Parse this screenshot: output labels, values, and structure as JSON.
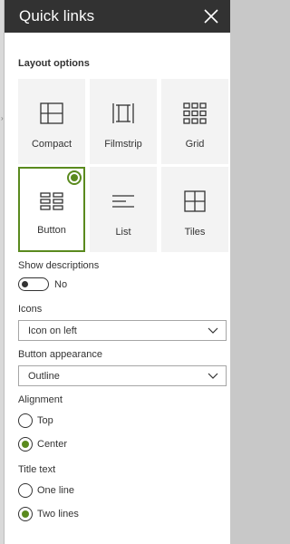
{
  "panel": {
    "title": "Quick links"
  },
  "layout": {
    "title": "Layout options",
    "options": [
      {
        "label": "Compact",
        "icon": "compact-layout-icon"
      },
      {
        "label": "Filmstrip",
        "icon": "filmstrip-layout-icon"
      },
      {
        "label": "Grid",
        "icon": "grid-layout-icon"
      },
      {
        "label": "Button",
        "icon": "button-layout-icon",
        "selected": true
      },
      {
        "label": "List",
        "icon": "list-layout-icon"
      },
      {
        "label": "Tiles",
        "icon": "tiles-layout-icon"
      }
    ]
  },
  "descriptions": {
    "label": "Show descriptions",
    "state": "No"
  },
  "icons": {
    "label": "Icons",
    "value": "Icon on left"
  },
  "appearance": {
    "label": "Button appearance",
    "value": "Outline"
  },
  "alignment": {
    "label": "Alignment",
    "options": [
      "Top",
      "Center"
    ],
    "selected": "Center"
  },
  "title_text": {
    "label": "Title text",
    "options": [
      "One line",
      "Two lines"
    ],
    "selected": "Two lines"
  },
  "colors": {
    "header": "#323232",
    "accent": "#5a8a1e"
  }
}
